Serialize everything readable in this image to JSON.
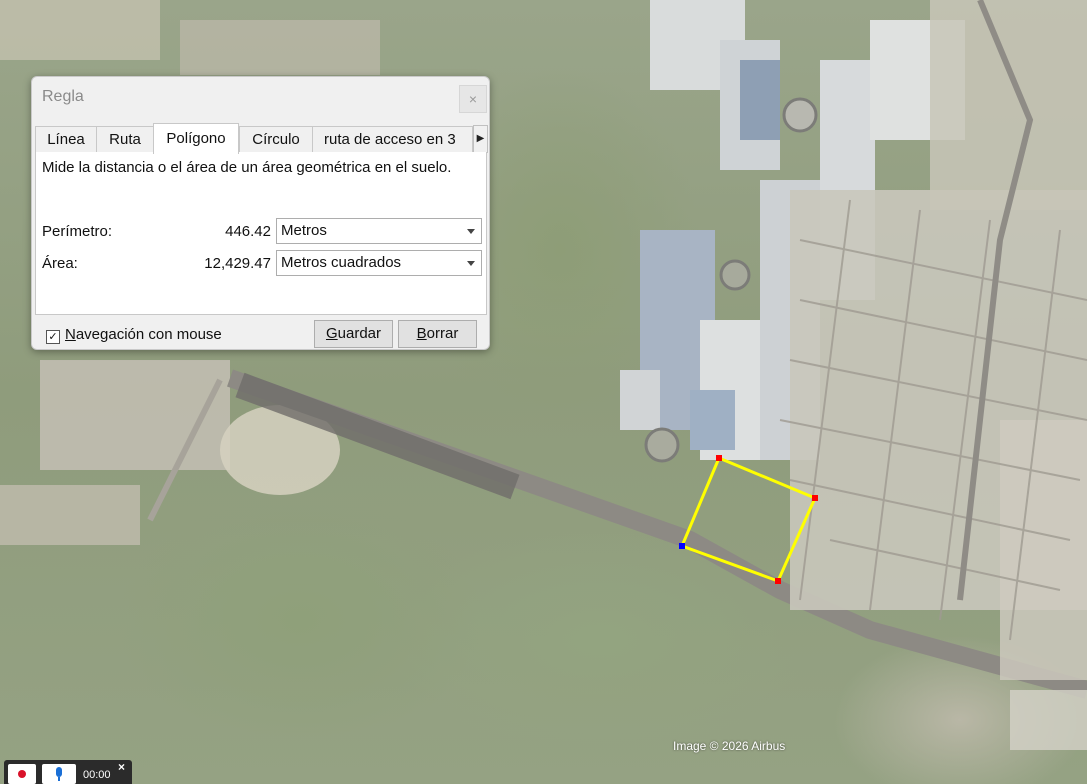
{
  "dialog": {
    "title": "Regla",
    "close_glyph": "×",
    "tabs": [
      {
        "label": "Línea"
      },
      {
        "label": "Ruta"
      },
      {
        "label": "Polígono",
        "active": true
      },
      {
        "label": "Círculo"
      },
      {
        "label": "ruta de acceso en 3"
      }
    ],
    "tab_scroll_glyph": "▶",
    "description": "Mide la distancia o el área de un área geométrica en el suelo.",
    "perimeter": {
      "label": "Perímetro:",
      "value": "446.42",
      "unit": "Metros"
    },
    "area": {
      "label": "Área:",
      "value": "12,429.47",
      "unit": "Metros cuadrados"
    },
    "mouse_nav": {
      "checked": true,
      "check_glyph": "✓",
      "label_first": "N",
      "label_rest": "avegación con mouse"
    },
    "save_button": {
      "label_first": "G",
      "label_rest": "uardar"
    },
    "clear_button": {
      "label_first": "B",
      "label_rest": "orrar"
    }
  },
  "map": {
    "copyright": "Image © 2026 Airbus",
    "polygon_color": "#ffff00",
    "vertex_color": "#ff0000",
    "active_vertex_color": "#0000ff"
  },
  "recorder": {
    "time": "00:00",
    "close_glyph": "×"
  }
}
